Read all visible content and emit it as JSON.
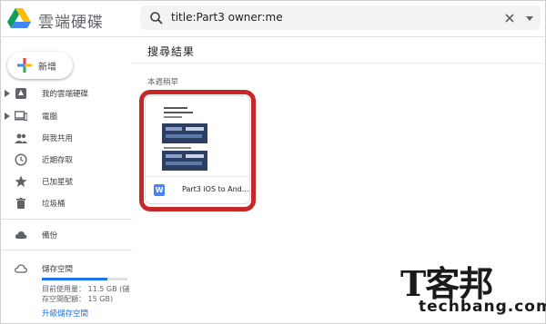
{
  "header": {
    "app_title": "雲端硬碟",
    "search_query": "title:Part3 owner:me"
  },
  "sidebar": {
    "new_label": "新增",
    "items": [
      {
        "label": "我的雲端硬碟",
        "icon": "drive-icon"
      },
      {
        "label": "電腦",
        "icon": "computer-icon"
      },
      {
        "label": "與我共用",
        "icon": "people-icon"
      },
      {
        "label": "近期存取",
        "icon": "clock-icon"
      },
      {
        "label": "已加星號",
        "icon": "star-icon"
      },
      {
        "label": "垃圾桶",
        "icon": "trash-icon"
      },
      {
        "label": "備份",
        "icon": "cloud-icon"
      }
    ],
    "storage": {
      "label": "儲存空間",
      "used_text": "目前使用量： 11.5 GB (儲",
      "quota_text": "存空間配額： 15 GB)",
      "used_fraction": 0.77,
      "upgrade_label": "升級儲存空間"
    }
  },
  "main": {
    "results_title": "搜尋結果",
    "section_label": "本週稍早",
    "file": {
      "name": "Part3 iOS to And...",
      "type_icon": "W"
    }
  },
  "watermark": {
    "main": "T客邦",
    "sub": "techbang.com"
  },
  "colors": {
    "accent": "#1a73e8",
    "highlight": "#c62828",
    "doc_blue": "#4285f4"
  }
}
